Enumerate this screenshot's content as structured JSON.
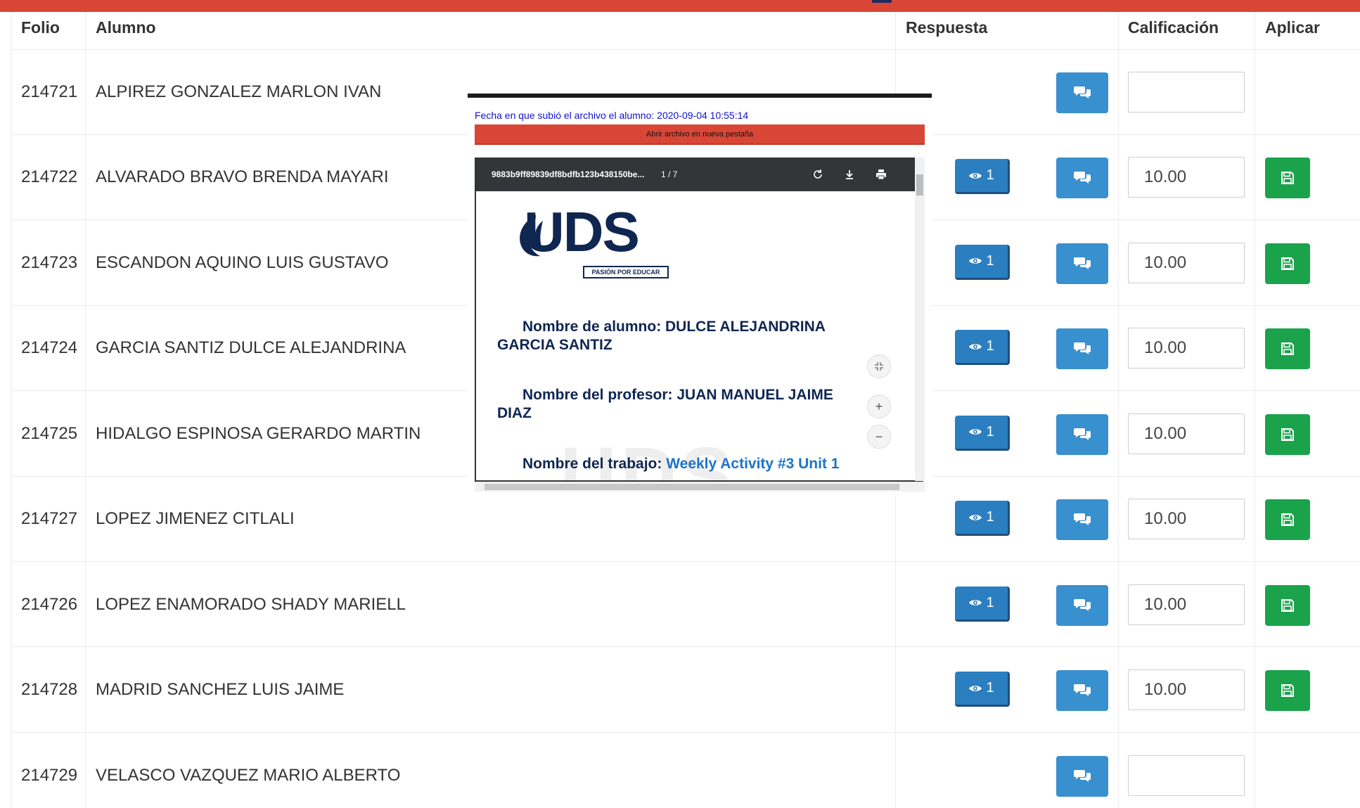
{
  "table": {
    "headers": {
      "folio": "Folio",
      "alumno": "Alumno",
      "respuesta": "Respuesta",
      "calificacion": "Calificación",
      "aplicar": "Aplicar"
    },
    "rows": [
      {
        "folio": "214721",
        "alumno": "ALPIREZ GONZALEZ MARLON IVAN",
        "views": "",
        "grade": ""
      },
      {
        "folio": "214722",
        "alumno": "ALVARADO BRAVO BRENDA MAYARI",
        "views": "1",
        "grade": "10.00"
      },
      {
        "folio": "214723",
        "alumno": "ESCANDON AQUINO LUIS GUSTAVO",
        "views": "1",
        "grade": "10.00"
      },
      {
        "folio": "214724",
        "alumno": "GARCIA SANTIZ DULCE ALEJANDRINA",
        "views": "1",
        "grade": "10.00"
      },
      {
        "folio": "214725",
        "alumno": "HIDALGO ESPINOSA GERARDO MARTIN",
        "views": "1",
        "grade": "10.00"
      },
      {
        "folio": "214727",
        "alumno": "LOPEZ JIMENEZ CITLALI",
        "views": "1",
        "grade": "10.00"
      },
      {
        "folio": "214726",
        "alumno": "LOPEZ ENAMORADO SHADY MARIELL",
        "views": "1",
        "grade": "10.00"
      },
      {
        "folio": "214728",
        "alumno": "MADRID SANCHEZ LUIS JAIME",
        "views": "1",
        "grade": "10.00"
      },
      {
        "folio": "214729",
        "alumno": "VELASCO VAZQUEZ MARIO ALBERTO",
        "views": "",
        "grade": ""
      }
    ]
  },
  "modal": {
    "upload_date": "Fecha en que subió el archivo el alumno: 2020-09-04 10:55:14",
    "open_button": "Abrir archivo en nueva pestaña",
    "pdf": {
      "filename": "9883b9ff89839df8bdfb123b438150be...",
      "page_current": "1",
      "page_info": " / 7",
      "logo": "UDS",
      "logo_tagline": "PASIÓN POR EDUCAR",
      "student_line": "Nombre de alumno: DULCE ALEJANDRINA GARCIA SANTIZ",
      "teacher_line": "Nombre del profesor: JUAN MANUEL JAIME DIAZ",
      "work_label": "Nombre del trabajo: ",
      "work_value": "Weekly Activity #3 Unit 1",
      "zoom_in": "+",
      "zoom_out": "−"
    }
  },
  "colors": {
    "topbar": "#d94636",
    "view_button": "#2b7fc1",
    "response_button": "#3990ce",
    "save_button": "#1aa34a",
    "date_text": "#1212d0"
  }
}
